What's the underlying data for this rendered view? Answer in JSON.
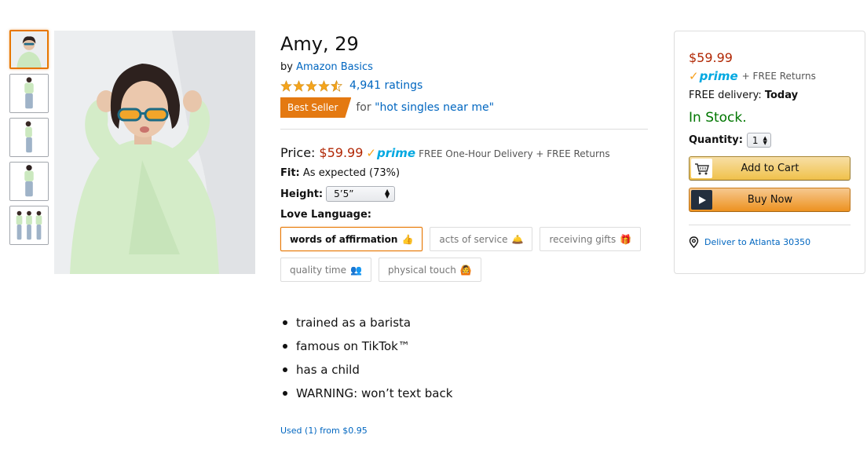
{
  "product": {
    "title": "Amy, 29",
    "by_prefix": "by",
    "brand": "Amazon Basics",
    "rating_value": 4.5,
    "ratings_text": "4,941 ratings",
    "badge": "Best Seller",
    "badge_for": "for",
    "badge_category": "\"hot singles near me\""
  },
  "pricing": {
    "price_label": "Price:",
    "price": "$59.99",
    "prime_label": "prime",
    "delivery_text": "FREE One-Hour Delivery + FREE Returns"
  },
  "fit": {
    "label": "Fit:",
    "value": "As expected (73%)"
  },
  "height": {
    "label": "Height:",
    "selected": "5’5”"
  },
  "love_language": {
    "label": "Love Language:",
    "options": [
      {
        "label": "words of affirmation",
        "emoji": "👍",
        "selected": true
      },
      {
        "label": "acts of service",
        "emoji": "🛎️",
        "selected": false
      },
      {
        "label": "receiving gifts",
        "emoji": "🎁",
        "selected": false
      },
      {
        "label": "quality time",
        "emoji": "👥",
        "selected": false
      },
      {
        "label": "physical touch",
        "emoji": "🙆",
        "selected": false
      }
    ]
  },
  "bullets": [
    "trained as a barista",
    "famous on TikTok™",
    "has a child",
    "WARNING: won’t text back"
  ],
  "used_offer": "Used (1) from $0.95",
  "buybox": {
    "price": "$59.99",
    "prime_label": "prime",
    "free_returns": "+ FREE Returns",
    "delivery_label": "FREE delivery:",
    "delivery_day": "Today",
    "stock": "In Stock.",
    "quantity_label": "Quantity:",
    "quantity": "1",
    "add_to_cart": "Add to Cart",
    "buy_now": "Buy Now",
    "deliver_to": "Deliver to Atlanta 30350"
  },
  "colors": {
    "link": "#0066c0",
    "price": "#b12704",
    "in_stock": "#007600",
    "badge": "#e47911",
    "prime": "#00a8e1",
    "selected_border": "#e77600"
  },
  "icons": {
    "cart": "cart-icon",
    "play": "play-icon",
    "location": "location-pin-icon",
    "star": "star-icon"
  }
}
